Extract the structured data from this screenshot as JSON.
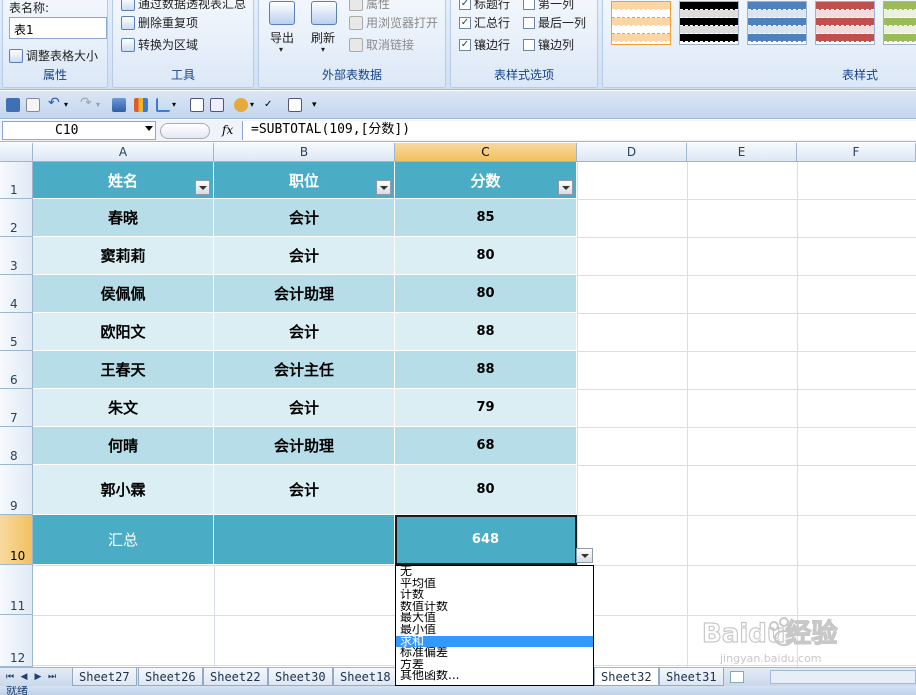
{
  "ribbon": {
    "table_name_label": "表名称:",
    "table_name_value": "表1",
    "resize_table": "调整表格大小",
    "group_properties": "属性",
    "summarize_pivot": "通过数据透视表汇总",
    "remove_duplicates": "删除重复项",
    "convert_to_range": "转换为区域",
    "group_tools": "工具",
    "export": "导出",
    "refresh": "刷新",
    "properties": "属性",
    "open_in_browser": "用浏览器打开",
    "unlink": "取消链接",
    "group_external": "外部表数据",
    "opt_header_row": "标题行",
    "opt_first_column": "第一列",
    "opt_total_row": "汇总行",
    "opt_last_column": "最后一列",
    "opt_banded_rows": "镶边行",
    "opt_banded_columns": "镶边列",
    "group_style_options": "表样式选项",
    "group_table_styles": "表样式"
  },
  "formula_bar": {
    "cell_ref": "C10",
    "fx": "fx",
    "formula": "=SUBTOTAL(109,[分数])"
  },
  "columns": [
    "A",
    "B",
    "C",
    "D",
    "E",
    "F"
  ],
  "rows": [
    "1",
    "2",
    "3",
    "4",
    "5",
    "6",
    "7",
    "8",
    "9",
    "10",
    "11",
    "12"
  ],
  "table": {
    "headers": [
      "姓名",
      "职位",
      "分数"
    ],
    "records": [
      [
        "春晓",
        "会计",
        "85"
      ],
      [
        "窦莉莉",
        "会计",
        "80"
      ],
      [
        "侯佩佩",
        "会计助理",
        "80"
      ],
      [
        "欧阳文",
        "会计",
        "88"
      ],
      [
        "王春天",
        "会计主任",
        "88"
      ],
      [
        "朱文",
        "会计",
        "79"
      ],
      [
        "何晴",
        "会计助理",
        "68"
      ],
      [
        "郭小霖",
        "会计",
        "80"
      ]
    ],
    "total_label": "汇总",
    "total_value": "648"
  },
  "function_list": {
    "options": [
      "无",
      "平均值",
      "计数",
      "数值计数",
      "最大值",
      "最小值",
      "求和",
      "标准偏差",
      "方差",
      "其他函数..."
    ],
    "selected": "求和"
  },
  "sheets": {
    "tabs": [
      "Sheet27",
      "Sheet26",
      "Sheet22",
      "Sheet30",
      "Sheet18",
      "Sheet32",
      "Sheet31"
    ],
    "active": "Sheet32"
  },
  "status": {
    "text": "就绪"
  },
  "watermark": {
    "brand": "Baidu经验",
    "url": "jingyan.baidu.com"
  },
  "colors": {
    "table_header": "#4bacc6",
    "band_dark": "#b6dde8",
    "band_light": "#daeef3",
    "selected_option": "#3399ff"
  }
}
